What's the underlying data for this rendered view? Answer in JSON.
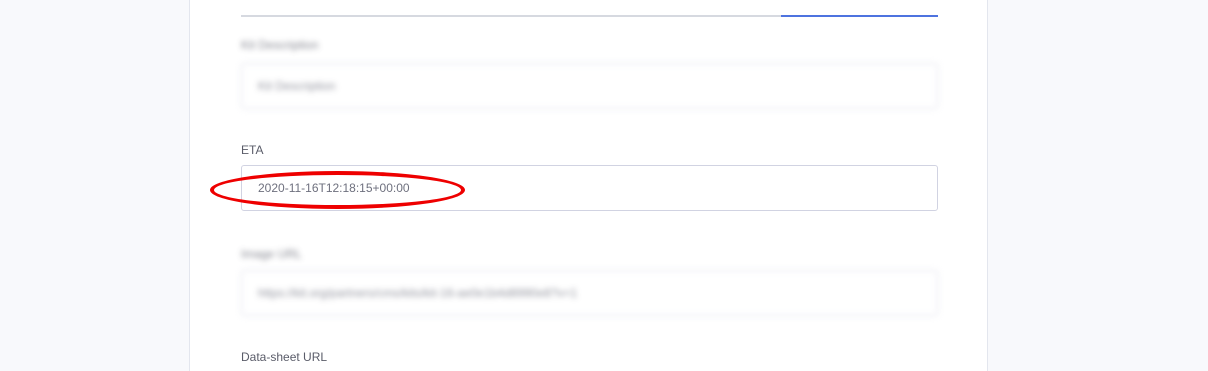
{
  "form": {
    "fields": {
      "kit_description": {
        "label": "Kit Description",
        "placeholder": "Kit Description",
        "value": ""
      },
      "eta": {
        "label": "ETA",
        "value": "2020-11-16T12:18:15+00:00"
      },
      "image_url": {
        "label": "Image URL",
        "value": "https://kit.org/partners/cms/kits/kit-16-ae0e1b4d8990e8?v=1"
      },
      "datasheet_url": {
        "label": "Data-sheet URL"
      }
    }
  },
  "colors": {
    "accent": "#4e73df",
    "annotation": "#ee0000",
    "border": "#d1d3e2",
    "label_text": "#5a5c69"
  }
}
